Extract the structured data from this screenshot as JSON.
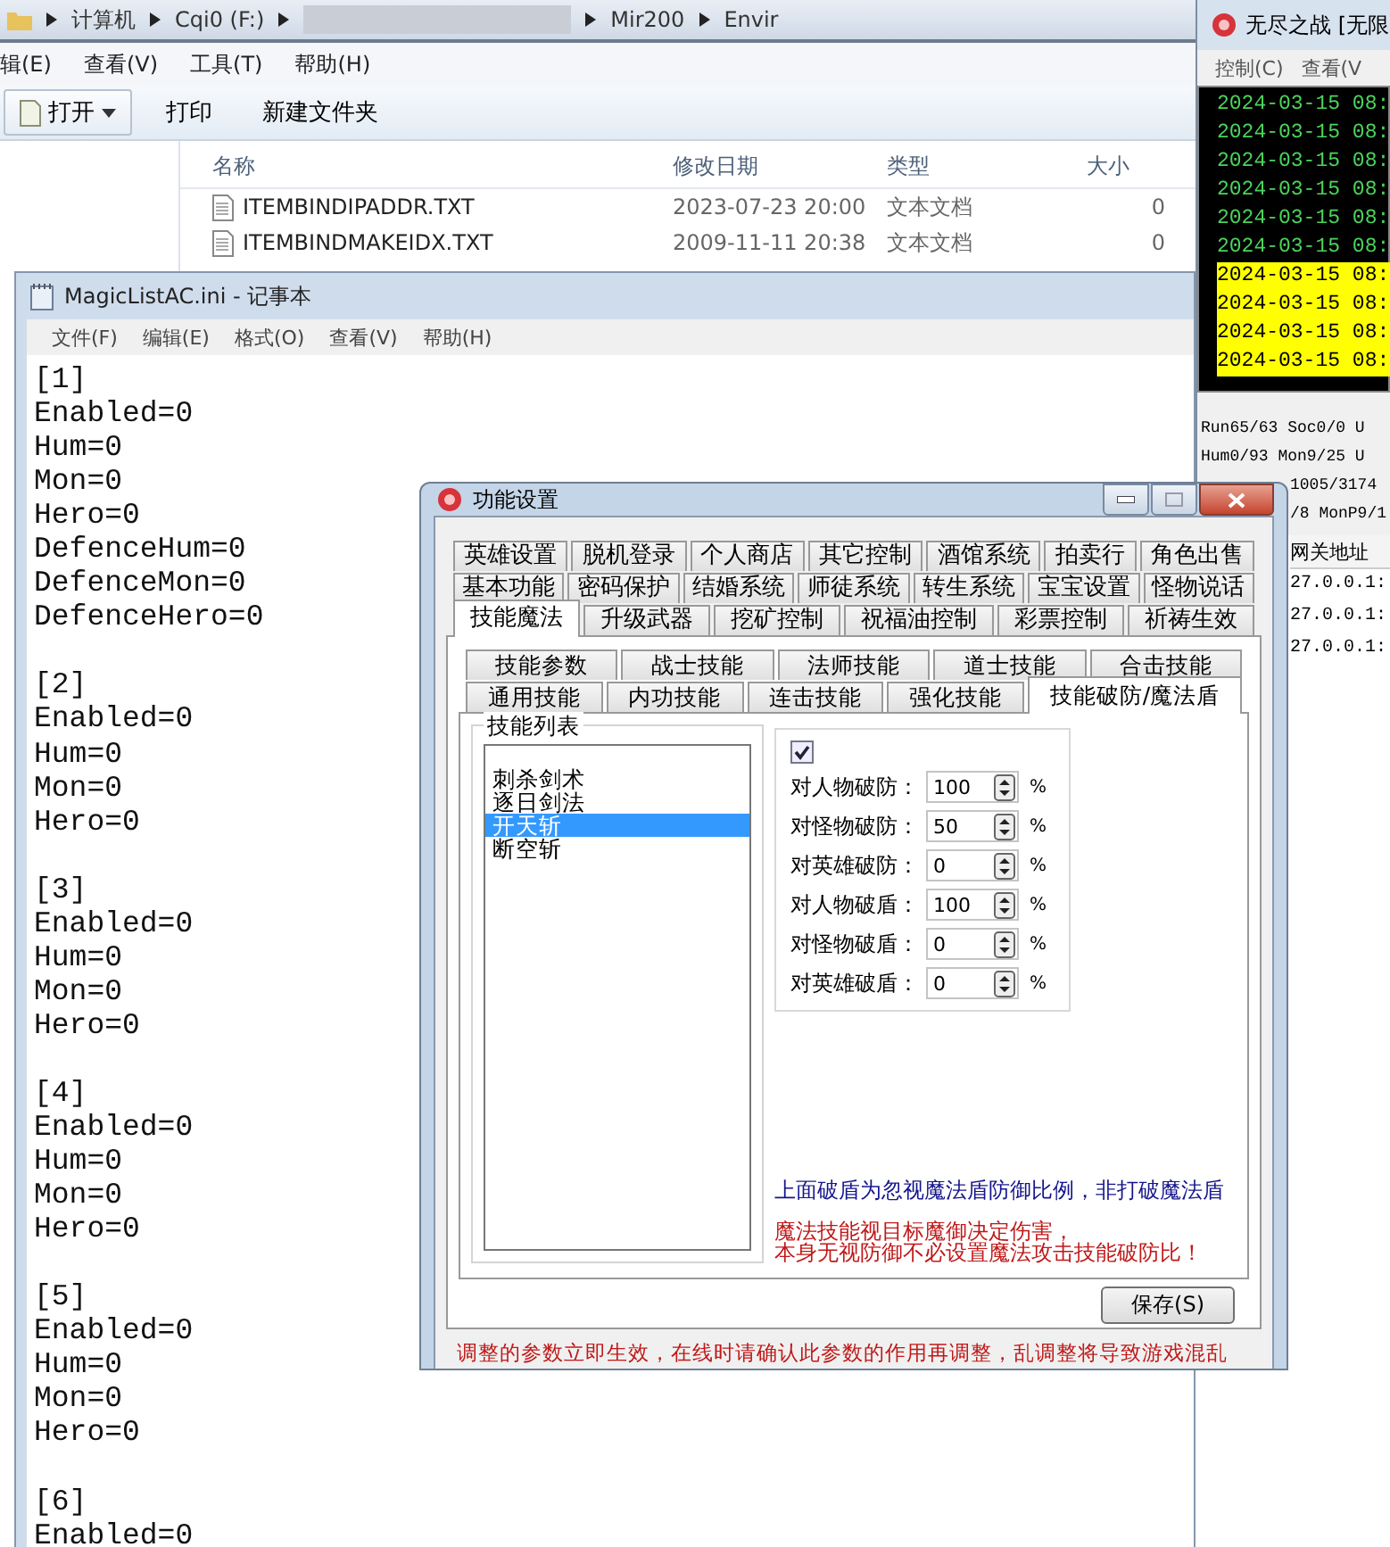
{
  "explorer": {
    "breadcrumb": [
      "计算机",
      "Cqi0 (F:)",
      "Mir200",
      "Envir"
    ],
    "menu": [
      "辑(E)",
      "查看(V)",
      "工具(T)",
      "帮助(H)"
    ],
    "toolbar": [
      {
        "label": "打开",
        "kind": "split"
      },
      {
        "label": "打印",
        "kind": "plain"
      },
      {
        "label": "新建文件夹",
        "kind": "plain"
      }
    ],
    "columns": [
      "名称",
      "修改日期",
      "类型",
      "大小"
    ],
    "files": [
      {
        "name": "ITEMBINDIPADDR.TXT",
        "modified": "2023-07-23 20:00",
        "type": "文本文档",
        "size": "0"
      },
      {
        "name": "ITEMBINDMAKEIDX.TXT",
        "modified": "2009-11-11 20:38",
        "type": "文本文档",
        "size": "0"
      }
    ]
  },
  "notepad": {
    "title": "MagicListAC.ini - 记事本",
    "menu": [
      "文件(F)",
      "编辑(E)",
      "格式(O)",
      "查看(V)",
      "帮助(H)"
    ],
    "sections": [
      {
        "lines": [
          "[1]",
          "Enabled=0",
          "Hum=0",
          "Mon=0",
          "Hero=0",
          "DefenceHum=0",
          "DefenceMon=0",
          "DefenceHero=0"
        ]
      },
      {
        "lines": [
          "[2]",
          "Enabled=0",
          "Hum=0",
          "Mon=0",
          "Hero=0"
        ]
      },
      {
        "lines": [
          "[3]",
          "Enabled=0",
          "Hum=0",
          "Mon=0",
          "Hero=0"
        ]
      },
      {
        "lines": [
          "[4]",
          "Enabled=0",
          "Hum=0",
          "Mon=0",
          "Hero=0"
        ]
      },
      {
        "lines": [
          "[5]",
          "Enabled=0",
          "Hum=0",
          "Mon=0",
          "Hero=0"
        ]
      },
      {
        "lines": [
          "[6]",
          "Enabled=0"
        ]
      }
    ]
  },
  "console": {
    "title": "无尽之战 [无限",
    "menu": [
      "控制(C)",
      "查看(V"
    ],
    "log": [
      {
        "text": "2024-03-15 08:",
        "highlighted": false
      },
      {
        "text": "2024-03-15 08:",
        "highlighted": false
      },
      {
        "text": "2024-03-15 08:",
        "highlighted": false
      },
      {
        "text": "2024-03-15 08:",
        "highlighted": false
      },
      {
        "text": "2024-03-15 08:",
        "highlighted": false
      },
      {
        "text": "2024-03-15 08:",
        "highlighted": false
      },
      {
        "text": "2024-03-15 08:",
        "highlighted": true
      },
      {
        "text": "2024-03-15 08:",
        "highlighted": true
      },
      {
        "text": "2024-03-15 08:",
        "highlighted": true
      },
      {
        "text": "2024-03-15 08:",
        "highlighted": true
      }
    ],
    "stats": [
      "Run65/63 Soc0/0 U",
      "Hum0/93 Mon9/25 U",
      "1005/3174",
      "/8 MonP9/1"
    ],
    "table": {
      "columns": [
        "网关地址"
      ],
      "rows": [
        "27.0.0.1:",
        "27.0.0.1:",
        "27.0.0.1:"
      ]
    }
  },
  "dialog": {
    "title": "功能设置",
    "tab_rows": [
      {
        "tabs": [
          {
            "label": "英雄设置",
            "selected": false
          },
          {
            "label": "脱机登录",
            "selected": false
          },
          {
            "label": "个人商店",
            "selected": false
          },
          {
            "label": "其它控制",
            "selected": false
          },
          {
            "label": "酒馆系统",
            "selected": false
          },
          {
            "label": "拍卖行",
            "selected": false
          },
          {
            "label": "角色出售",
            "selected": false
          }
        ]
      },
      {
        "tabs": [
          {
            "label": "基本功能",
            "selected": false
          },
          {
            "label": "密码保护",
            "selected": false
          },
          {
            "label": "结婚系统",
            "selected": false
          },
          {
            "label": "师徒系统",
            "selected": false
          },
          {
            "label": "转生系统",
            "selected": false
          },
          {
            "label": "宝宝设置",
            "selected": false
          },
          {
            "label": "怪物说话",
            "selected": false
          }
        ]
      },
      {
        "tabs": [
          {
            "label": "技能魔法",
            "selected": true
          },
          {
            "label": "升级武器",
            "selected": false
          },
          {
            "label": "挖矿控制",
            "selected": false
          },
          {
            "label": "祝福油控制",
            "selected": false
          },
          {
            "label": "彩票控制",
            "selected": false
          },
          {
            "label": "祈祷生效",
            "selected": false
          }
        ]
      }
    ],
    "subtab_rows": [
      {
        "tabs": [
          {
            "label": "技能参数",
            "selected": false
          },
          {
            "label": "战士技能",
            "selected": false
          },
          {
            "label": "法师技能",
            "selected": false
          },
          {
            "label": "道士技能",
            "selected": false
          },
          {
            "label": "合击技能",
            "selected": false
          }
        ]
      },
      {
        "tabs": [
          {
            "label": "通用技能",
            "selected": false
          },
          {
            "label": "内功技能",
            "selected": false
          },
          {
            "label": "连击技能",
            "selected": false
          },
          {
            "label": "强化技能",
            "selected": false
          },
          {
            "label": "技能破防/魔法盾",
            "selected": true
          }
        ]
      }
    ],
    "list": {
      "title": "技能列表",
      "items": [
        {
          "label": "刺杀剑术",
          "selected": false
        },
        {
          "label": "逐日剑法",
          "selected": false
        },
        {
          "label": "开天斩",
          "selected": true
        },
        {
          "label": "断空斩",
          "selected": false
        }
      ]
    },
    "checkbox": {
      "checked": true
    },
    "fields": [
      {
        "label": "对人物破防：",
        "value": "100",
        "unit": "%"
      },
      {
        "label": "对怪物破防：",
        "value": "50",
        "unit": "%"
      },
      {
        "label": "对英雄破防：",
        "value": "0",
        "unit": "%"
      },
      {
        "label": "对人物破盾：",
        "value": "100",
        "unit": "%"
      },
      {
        "label": "对怪物破盾：",
        "value": "0",
        "unit": "%"
      },
      {
        "label": "对英雄破盾：",
        "value": "0",
        "unit": "%"
      }
    ],
    "notes": [
      {
        "text": "上面破盾为忽视魔法盾防御比例，非打破魔法盾",
        "kind": "info"
      },
      {
        "text": "魔法技能视目标魔御决定伤害，",
        "kind": "warning"
      },
      {
        "text": "本身无视防御不必设置魔法攻击技能破防比！",
        "kind": "warning"
      }
    ],
    "save_button": "保存(S)",
    "footer": "调整的参数立即生效，在线时请确认此参数的作用再调整，乱调整将导致游戏混乱"
  }
}
